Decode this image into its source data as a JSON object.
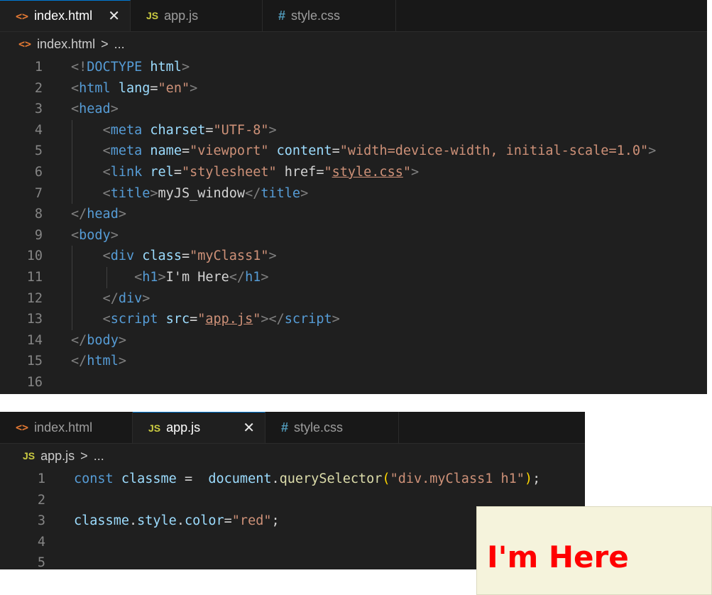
{
  "editor1": {
    "tabs": [
      {
        "icon": "<>",
        "label": "index.html",
        "close": "✕"
      },
      {
        "icon": "JS",
        "label": "app.js"
      },
      {
        "icon": "#",
        "label": "style.css"
      }
    ],
    "breadcrumb": {
      "icon": "<>",
      "file": "index.html",
      "sep": ">",
      "more": "..."
    },
    "line_numbers": [
      "1",
      "2",
      "3",
      "4",
      "5",
      "6",
      "7",
      "8",
      "9",
      "10",
      "11",
      "12",
      "13",
      "14",
      "15",
      "16"
    ],
    "lines": [
      [
        "<!",
        "DOCTYPE",
        " ",
        "html",
        ">"
      ],
      [
        "<",
        "html",
        " ",
        "lang",
        "=",
        "\"en\"",
        ">"
      ],
      [
        "<",
        "head",
        ">"
      ],
      [
        "<",
        "meta",
        " ",
        "charset",
        "=",
        "\"UTF-8\"",
        ">"
      ],
      [
        "<",
        "meta",
        " ",
        "name",
        "=",
        "\"viewport\"",
        " ",
        "content",
        "=",
        "\"width=device-width, initial-scale=1.0\"",
        ">"
      ],
      [
        "<",
        "link",
        " ",
        "rel",
        "=",
        "\"stylesheet\"",
        " ",
        "href",
        "=",
        "\"",
        "style.css",
        "\"",
        ">"
      ],
      [
        "<",
        "title",
        ">",
        "myJS_window",
        "</",
        "title",
        ">"
      ],
      [
        "</",
        "head",
        ">"
      ],
      [
        "<",
        "body",
        ">"
      ],
      [
        "<",
        "div",
        " ",
        "class",
        "=",
        "\"myClass1\"",
        ">"
      ],
      [
        "<",
        "h1",
        ">",
        "I'm Here",
        "</",
        "h1",
        ">"
      ],
      [
        "</",
        "div",
        ">"
      ],
      [
        "<",
        "script",
        " ",
        "src",
        "=",
        "\"",
        "app.js",
        "\"",
        "></",
        "script",
        ">"
      ],
      [
        "</",
        "body",
        ">"
      ],
      [
        "</",
        "html",
        ">"
      ],
      []
    ]
  },
  "editor2": {
    "tabs": [
      {
        "icon": "<>",
        "label": "index.html"
      },
      {
        "icon": "JS",
        "label": "app.js",
        "close": "✕"
      },
      {
        "icon": "#",
        "label": "style.css"
      }
    ],
    "breadcrumb": {
      "icon": "JS",
      "file": "app.js",
      "sep": ">",
      "more": "..."
    },
    "line_numbers": [
      "1",
      "2",
      "3",
      "4",
      "5"
    ],
    "lines": [
      [
        "const",
        " ",
        "classme",
        " =  ",
        "document",
        ".",
        "querySelector",
        "(",
        "\"div.myClass1 h1\"",
        ")",
        ";"
      ],
      [],
      [
        "classme",
        ".",
        "style",
        ".",
        "color",
        "=",
        "\"red\"",
        ";"
      ],
      [],
      []
    ]
  },
  "preview": {
    "heading": "I'm Here"
  },
  "colors": {
    "editor_bg": "#1f1f1f",
    "tabbar_bg": "#181818",
    "tag": "#569cd6",
    "attr": "#9cdcfe",
    "string": "#ce9178",
    "function": "#dcdcaa",
    "preview_bg": "#f5f3dc",
    "preview_text": "#ff0000"
  },
  "icons": [
    "html-file-icon",
    "js-file-icon",
    "css-file-icon",
    "close-icon",
    "chevron-right-icon"
  ]
}
